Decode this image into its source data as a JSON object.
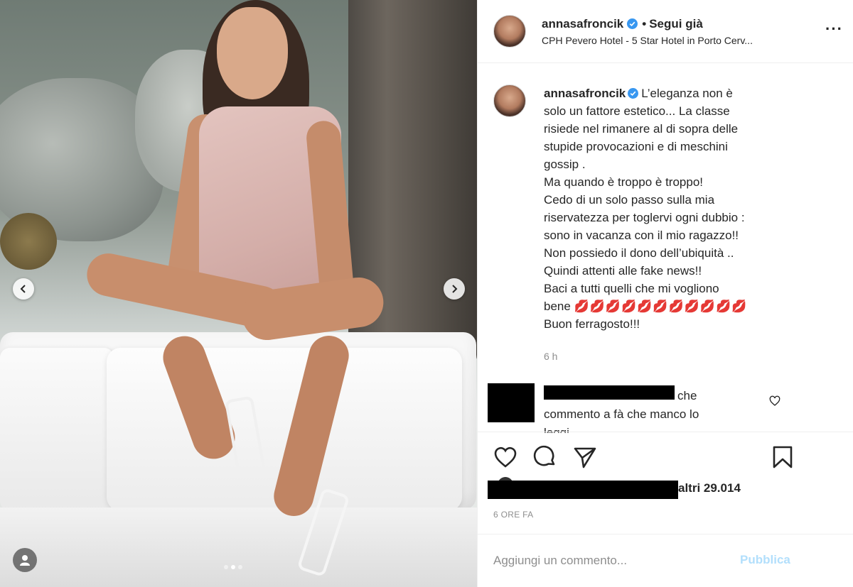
{
  "post": {
    "username": "annasafroncik",
    "separator": "•",
    "follow_label": "Segui già",
    "location": "CPH Pevero Hotel - 5 Star Hotel in Porto Cerv...",
    "more_label": "···"
  },
  "caption": {
    "username": "annasafroncik",
    "lines": [
      "L’eleganza non è",
      "solo un fattore estetico... La classe",
      "risiede nel rimanere al di sopra delle",
      "stupide provocazioni e di meschini",
      "gossip .",
      "Ma quando è troppo è troppo!",
      "Cedo di un solo passo sulla mia",
      "riservatezza per toglervi ogni dubbio :",
      "sono in vacanza con il mio ragazzo!!",
      "Non possiedo il dono dell’ubiquità ..",
      "Quindi attenti alle fake news!!",
      "Baci a tutti quelli che mi vogliono",
      "bene",
      "Buon ferragosto!!!"
    ],
    "lips": "💋💋💋💋💋💋💋💋💋💋💋",
    "time": "6 h"
  },
  "comment": {
    "text_end": "che",
    "text_line2": "commento a fà che manco lo",
    "text_line3": "leggi"
  },
  "likes": {
    "text": "altri 29.014"
  },
  "posted": "6 ORE FA",
  "compose": {
    "placeholder": "Aggiungi un commento...",
    "publish_label": "Pubblica"
  },
  "carousel": {
    "total": 3,
    "active_index": 1
  },
  "colors": {
    "verified": "#3897f0",
    "publish_disabled": "#b2dffc",
    "muted": "#8e8e8e"
  }
}
